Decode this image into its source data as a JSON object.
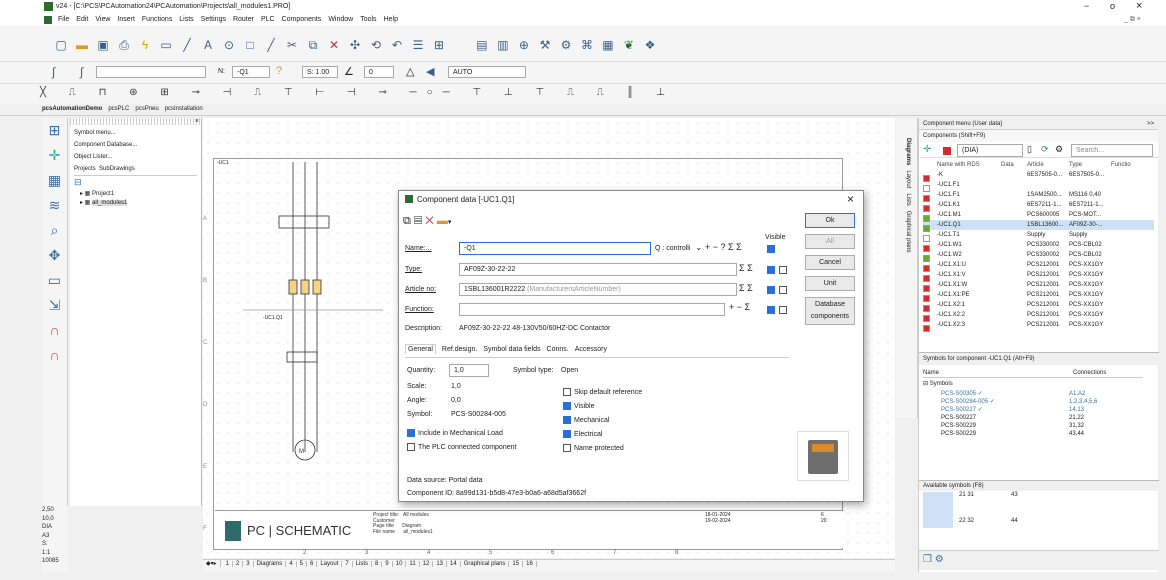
{
  "window": {
    "title": "v24 - [C:\\PCS\\PCAutomation24\\PCAutomation\\Projects\\all_modules1.PRO]",
    "min": "−",
    "restore": "o",
    "close": "×",
    "inner_controls": "_ ⧉ ×"
  },
  "menu": [
    "File",
    "Edit",
    "View",
    "Insert",
    "Functions",
    "Lists",
    "Settings",
    "Router",
    "PLC",
    "Components",
    "Window",
    "Tools",
    "Help"
  ],
  "toolbar2": {
    "n_label": "N:",
    "n_value": "-Q1",
    "s_value": "S: 1.00",
    "level": "0",
    "auto": "AUTO"
  },
  "file_tabs": [
    "pcsAutomationDemo",
    "pcsPLC",
    "pcsPneu",
    "pcsInstallation"
  ],
  "left_panel": {
    "items": [
      "Symbol menu...",
      "Component Database...",
      "Object Lister..."
    ],
    "tabs": [
      "Projects",
      "SubDrawings"
    ],
    "tree": [
      "Project1",
      "all_modules1"
    ]
  },
  "left_status": [
    "2,50",
    "10,0",
    "DIA",
    "A3",
    "S:",
    "1:1",
    "10085"
  ],
  "drawing": {
    "contactor_label": "-UC1",
    "bus_label": "-UC1.Q1",
    "title_block_brand": "PC | SCHEMATIC",
    "project": "All modules",
    "page_title": "Diagram",
    "file_name": "all_modules1",
    "page": "6",
    "date1": "18-01-2024",
    "date2": "19-02-2024",
    "total": "20",
    "col_numbers": [
      "2",
      "3",
      "4",
      "5",
      "6",
      "7",
      "8"
    ],
    "row_letters": [
      "A",
      "B",
      "C",
      "D",
      "E",
      "F"
    ]
  },
  "page_tabs": [
    "1",
    "2",
    "3",
    "Diagrams",
    "4",
    "5",
    "6",
    "Layout",
    "7",
    "Lists",
    "8",
    "9",
    "10",
    "11",
    "12",
    "13",
    "14",
    "Graphical plans",
    "15",
    "16"
  ],
  "dialog": {
    "title": "Component data [-UC1.Q1]",
    "visible_label": "Visible",
    "name_label": "Name:...",
    "name_value": "-Q1",
    "name_suffix": "Q : controlli",
    "type_label": "Type:",
    "type_value": "AF09Z-30-22-22",
    "article_label": "Article no:",
    "article_value": "1SBL136001R2222",
    "article_hint": "(ManufacturersArticleNumber)",
    "function_label": "Function:",
    "desc_label": "Description:",
    "desc_value": "AF09Z-30-22-22 48-130V50/60HZ-DC Contactor",
    "tabs": [
      "General",
      "Ref.design.",
      "Symbol data fields",
      "Conns.",
      "Accessory"
    ],
    "qty_label": "Quantity:",
    "qty_value": "1,0",
    "symtype_label": "Symbol type:",
    "symtype_value": "Open",
    "scale_label": "Scale:",
    "scale_value": "1,0",
    "angle_label": "Angle:",
    "angle_value": "0,0",
    "symbol_label": "Symbol:",
    "symbol_value": "PCS-S00284-005",
    "checks": [
      {
        "label": "Skip default reference",
        "on": false
      },
      {
        "label": "Visible",
        "on": true
      },
      {
        "label": "Mechanical",
        "on": true
      },
      {
        "label": "Electrical",
        "on": true
      },
      {
        "label": "Name protected",
        "on": false
      }
    ],
    "include_mech": "Include in Mechanical Load",
    "plc_connected": "The PLC connected component",
    "data_source": "Data source: Portal data",
    "component_id": "Component ID: 8a99d131-b5d8-47e3-b0a6-a68d5af3662f",
    "buttons": [
      "Ok",
      "All",
      "Cancel",
      "Unit",
      "Database",
      "components"
    ]
  },
  "right_panel": {
    "header": "Component menu (User data)",
    "sub": "Components (Shift+F9)",
    "dia": "(DIA)",
    "search": "Search...",
    "side_tabs": [
      "Diagrams",
      "Layout",
      "Lists",
      "Graphical plans"
    ],
    "columns": [
      "Name with RDS",
      "Data",
      "Article",
      "Type",
      "Functio"
    ],
    "rows": [
      [
        "-K",
        "",
        "6ES7505-0...",
        "6ES7505-0..."
      ],
      [
        "-UC1.F1",
        "",
        "",
        ""
      ],
      [
        "-UC1.F1",
        "",
        "1SAM2500...",
        "MS116 0,40"
      ],
      [
        "-UC1.K1",
        "",
        "6ES7211-1...",
        "6ES7211-1..."
      ],
      [
        "-UC1.M1",
        "",
        "PCS600005",
        "PCS-MOT..."
      ],
      [
        "-UC1.Q1",
        "",
        "1SBL13600...",
        "AF09Z-30-..."
      ],
      [
        "-UC1.T1",
        "",
        "Supply",
        "Supply"
      ],
      [
        "-UC1.W1",
        "",
        "PCS330002",
        "PCS-CBL02"
      ],
      [
        "-UC1.W2",
        "",
        "PCS330002",
        "PCS-CBL02"
      ],
      [
        "-UC1.X1:U",
        "",
        "PCS212001",
        "PCS-XX1GY"
      ],
      [
        "-UC1.X1:V",
        "",
        "PCS212001",
        "PCS-XX1GY"
      ],
      [
        "-UC1.X1:W",
        "",
        "PCS212001",
        "PCS-XX1GY"
      ],
      [
        "-UC1.X1:PE",
        "",
        "PCS212001",
        "PCS-XX1GY"
      ],
      [
        "-UC1.X2:1",
        "",
        "PCS212001",
        "PCS-XX1GY"
      ],
      [
        "-UC1.X2:2",
        "",
        "PCS212001",
        "PCS-XX1GY"
      ],
      [
        "-UC1.X2:3",
        "",
        "PCS212001",
        "PCS-XX1GY"
      ]
    ],
    "symbols_header": "Symbols for component -UC1.Q1 (Alt+F9)",
    "sym_cols": [
      "Name",
      "Connections"
    ],
    "sym_group": "Symbols",
    "symbols": [
      [
        "PCS-S00305 ✓",
        "A1,A2"
      ],
      [
        "PCS-S00284-005 ✓",
        "1,2,3,4,5,6"
      ],
      [
        "PCS-S00227 ✓",
        "14,13"
      ],
      [
        "PCS-S00227",
        "21,22"
      ],
      [
        "PCS-S00229",
        "31,32"
      ],
      [
        "PCS-S00229",
        "43,44"
      ]
    ],
    "available_header": "Available symbols (F8)",
    "avail_nums": [
      "21 31",
      "43",
      "22 32",
      "44"
    ]
  }
}
